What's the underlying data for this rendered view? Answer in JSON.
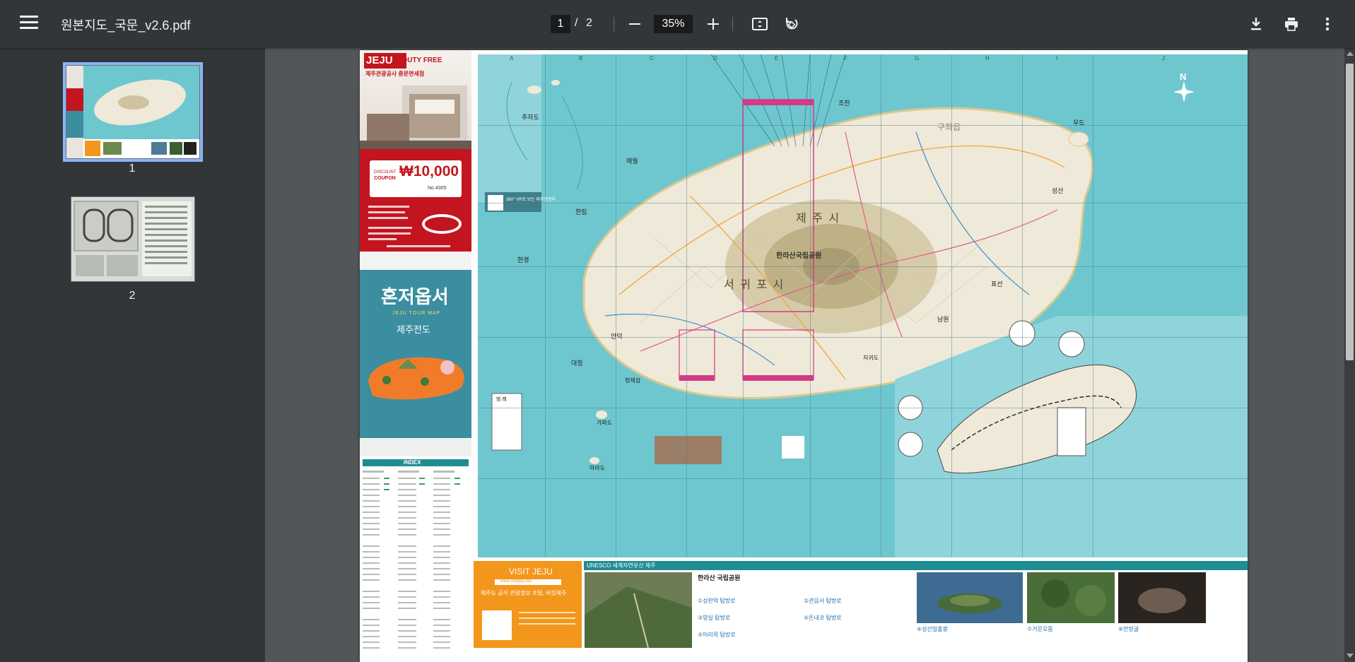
{
  "toolbar": {
    "title": "원본지도_국문_v2.6.pdf",
    "current_page": "1",
    "separator": "/",
    "total_pages": "2",
    "zoom": "35%"
  },
  "thumbnails": [
    {
      "label": "1",
      "selected": true
    },
    {
      "label": "2",
      "selected": false
    }
  ],
  "map_page": {
    "dutyfree": {
      "brand_top": "JEJU",
      "brand_bottom": "DUTY FREE",
      "subtitle": "제주관광공사 중문면세점"
    },
    "coupon": {
      "discount": "DISCOUNT",
      "coupon": "COUPON",
      "amount": "₩10,000",
      "number": "No.4305"
    },
    "cover": {
      "title": "혼저옵서",
      "subtitle": "JEJU TOUR MAP",
      "name": "제주전도"
    },
    "index": {
      "title": "INDEX"
    },
    "legend_title": "범 례",
    "map_labels": {
      "jeju_city": "제 주 시",
      "seogwipo_city": "서 귀 포 시",
      "hallasan": "한라산국립공원",
      "hallim": "한림",
      "aewol": "애월",
      "hangyeong": "한경",
      "daejeong": "대정",
      "andeok": "안덕",
      "namwon": "남원",
      "pyoseon": "표선",
      "seongsan": "성산",
      "gujwa": "구좌읍",
      "jocheon": "조천",
      "udo": "우도",
      "chujado": "추자도",
      "gapado": "가파도",
      "marado": "마라도",
      "hyeongje": "형제섬",
      "jigwido": "지귀도",
      "compass": "N",
      "col_letters": [
        "A",
        "B",
        "C",
        "D",
        "E",
        "F",
        "G",
        "H",
        "I",
        "J"
      ],
      "qr_text": "360° VR로 보는 제주관광지"
    },
    "visit_jeju": {
      "title": "VISIT JEJU",
      "url": "www.visitjeju.net",
      "tagline": "제주도 공식 관광정보 포털, 비짓제주"
    },
    "unesco": {
      "bar": "UNESCO 세계자연유산 제주",
      "hallasan_title": "한라산 국립공원",
      "trail_1": "①성판악 탐방로",
      "trail_2": "②관음사 탐방로",
      "trail_3": "③영실 탐방로",
      "trail_4": "④돈내코 탐방로",
      "trail_5": "⑤어리목 탐방로",
      "site_6": "⑥성산일출봉",
      "site_7": "⑦거문오름",
      "site_8": "⑧만장굴"
    }
  },
  "colors": {
    "toolbar_bg": "#323639",
    "viewer_bg": "#525659",
    "selected_outline": "#8ab4f8",
    "sea": "#6ec7cf",
    "land": "#efe9d9",
    "coupon_red": "#c3151f",
    "visit_orange": "#f3961c"
  },
  "icons": [
    "menu-icon",
    "fit-page-icon",
    "rotate-icon",
    "download-icon",
    "print-icon",
    "more-vert-icon"
  ]
}
